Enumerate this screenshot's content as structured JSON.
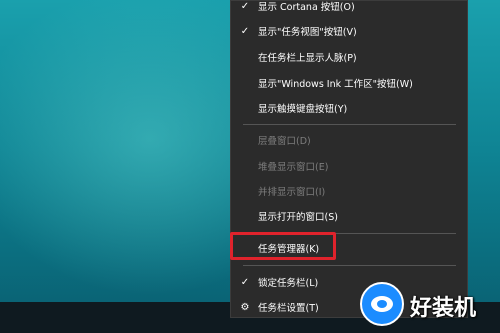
{
  "menu": {
    "items": [
      {
        "label": "显示 Cortana 按钮(O)",
        "checked": true,
        "disabled": false
      },
      {
        "label": "显示\"任务视图\"按钮(V)",
        "checked": true,
        "disabled": false
      },
      {
        "label": "在任务栏上显示人脉(P)",
        "checked": false,
        "disabled": false
      },
      {
        "label": "显示\"Windows Ink 工作区\"按钮(W)",
        "checked": false,
        "disabled": false
      },
      {
        "label": "显示触摸键盘按钮(Y)",
        "checked": false,
        "disabled": false
      },
      {
        "label": "层叠窗口(D)",
        "checked": false,
        "disabled": true
      },
      {
        "label": "堆叠显示窗口(E)",
        "checked": false,
        "disabled": true
      },
      {
        "label": "并排显示窗口(I)",
        "checked": false,
        "disabled": true
      },
      {
        "label": "显示打开的窗口(S)",
        "checked": false,
        "disabled": false
      },
      {
        "label": "任务管理器(K)",
        "checked": false,
        "disabled": false,
        "highlighted": true
      },
      {
        "label": "锁定任务栏(L)",
        "checked": true,
        "disabled": false
      },
      {
        "label": "任务栏设置(T)",
        "checked": false,
        "disabled": false,
        "icon": "gear-icon"
      }
    ],
    "check_glyph": "✓",
    "gear_glyph": "⚙"
  },
  "watermark": {
    "text": "好装机",
    "logo_icon": "eye-logo-icon",
    "color": "#1b8cff"
  },
  "colors": {
    "menu_bg": "#2b2b2b",
    "highlight_border": "#e0232c",
    "disabled_text": "#7d7d7d"
  }
}
